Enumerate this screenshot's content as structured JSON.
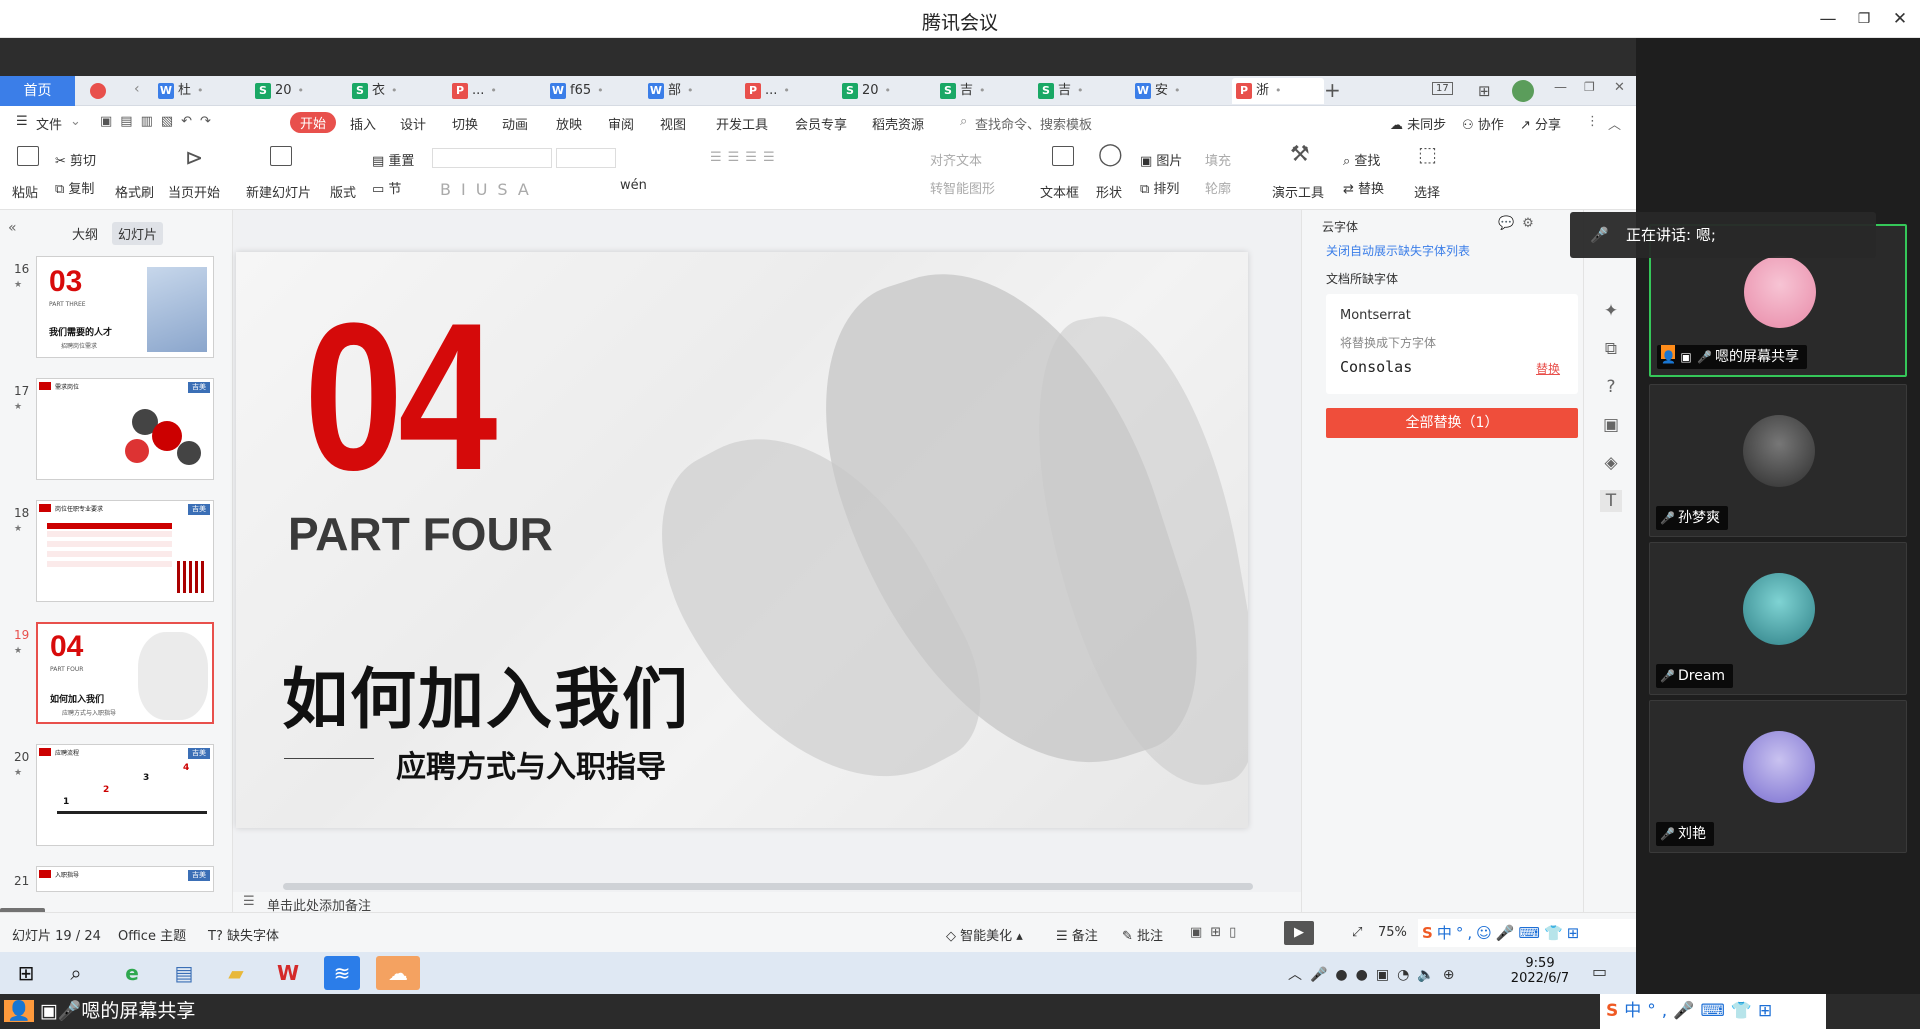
{
  "window": {
    "title": "腾讯会议"
  },
  "tabs": {
    "home": "首页",
    "items": [
      {
        "label": "杜",
        "icon": "W",
        "color": "#3b7ee8"
      },
      {
        "label": "20",
        "icon": "S",
        "color": "#1aa865"
      },
      {
        "label": "衣",
        "icon": "S",
        "color": "#1aa865"
      },
      {
        "label": "...",
        "icon": "P",
        "color": "#e8504c"
      },
      {
        "label": "f65",
        "icon": "W",
        "color": "#3b7ee8"
      },
      {
        "label": "部",
        "icon": "W",
        "color": "#3b7ee8"
      },
      {
        "label": "...",
        "icon": "P",
        "color": "#e8504c"
      },
      {
        "label": "20",
        "icon": "S",
        "color": "#1aa865"
      },
      {
        "label": "吉",
        "icon": "S",
        "color": "#1aa865"
      },
      {
        "label": "吉",
        "icon": "S",
        "color": "#1aa865"
      },
      {
        "label": "安",
        "icon": "W",
        "color": "#3b7ee8"
      },
      {
        "label": "浙",
        "icon": "P",
        "color": "#e8504c"
      }
    ],
    "add": "+",
    "page_indicator": "17"
  },
  "menu": {
    "file": "文件",
    "items": [
      "开始",
      "插入",
      "设计",
      "切换",
      "动画",
      "放映",
      "审阅",
      "视图",
      "开发工具",
      "会员专享",
      "稻壳资源"
    ],
    "search": "查找命令、搜索模板",
    "sync": "未同步",
    "collab": "协作",
    "share": "分享"
  },
  "ribbon": {
    "paste": "粘贴",
    "cut": "剪切",
    "copy": "复制",
    "format_painter": "格式刷",
    "from_current": "当页开始",
    "new_slide": "新建幻灯片",
    "layout": "版式",
    "section": "节",
    "reset": "重置",
    "align_text": "对齐文本",
    "smart_shape": "转智能图形",
    "textbox": "文本框",
    "shape": "形状",
    "picture": "图片",
    "fill": "填充",
    "arrange": "排列",
    "outline": "轮廓",
    "present_tools": "演示工具",
    "find": "查找",
    "replace": "替换",
    "select": "选择",
    "wen": "wén"
  },
  "left_panel": {
    "tab_outline": "大纲",
    "tab_slides": "幻灯片",
    "slides": [
      {
        "num": "16",
        "big": "03",
        "part": "PART THREE",
        "title": "我们需要的人才",
        "sub": "招聘岗位需求"
      },
      {
        "num": "17",
        "badge": "吉美",
        "title": "需求岗位"
      },
      {
        "num": "18",
        "badge": "吉美",
        "title": "岗位任职专业要求"
      },
      {
        "num": "19",
        "big": "04",
        "part": "PART FOUR",
        "title": "如何加入我们",
        "sub": "应聘方式与入职指导"
      },
      {
        "num": "20",
        "badge": "吉美",
        "title": "应聘流程",
        "steps": [
          "1",
          "2",
          "3",
          "4"
        ]
      },
      {
        "num": "21",
        "badge": "吉美",
        "title": "入职指导"
      }
    ],
    "add": "+"
  },
  "slide": {
    "number": "04",
    "part": "PART FOUR",
    "title": "如何加入我们",
    "subtitle": "应聘方式与入职指导"
  },
  "notes": {
    "placeholder": "单击此处添加备注"
  },
  "font_panel": {
    "header": "云字体",
    "close_link": "关闭自动展示缺失字体列表",
    "missing_title": "文档所缺字体",
    "missing_font": "Montserrat",
    "replace_with": "将替换成下方字体",
    "replacement_font": "Consolas",
    "replace_link": "替换",
    "replace_all": "全部替换（1）"
  },
  "status": {
    "slide_count": "幻灯片 19 / 24",
    "theme": "Office 主题",
    "missing_font": "缺失字体",
    "smart_beautify": "智能美化",
    "notes": "备注",
    "comments": "批注",
    "zoom": "75%"
  },
  "taskbar": {
    "time": "9:59",
    "date": "2022/6/7",
    "ime": "中"
  },
  "meeting": {
    "speaking": "正在讲话: 嗯;",
    "participants": [
      {
        "name": "嗯的屏幕共享",
        "avatar_color": "#e89ab4"
      },
      {
        "name": "孙梦爽",
        "avatar_color": "#4a4a4a"
      },
      {
        "name": "Dream",
        "avatar_color": "#4aa3a8"
      },
      {
        "name": "刘艳",
        "avatar_color": "#9a8fd8"
      }
    ],
    "share_label": "嗯的屏幕共享"
  }
}
